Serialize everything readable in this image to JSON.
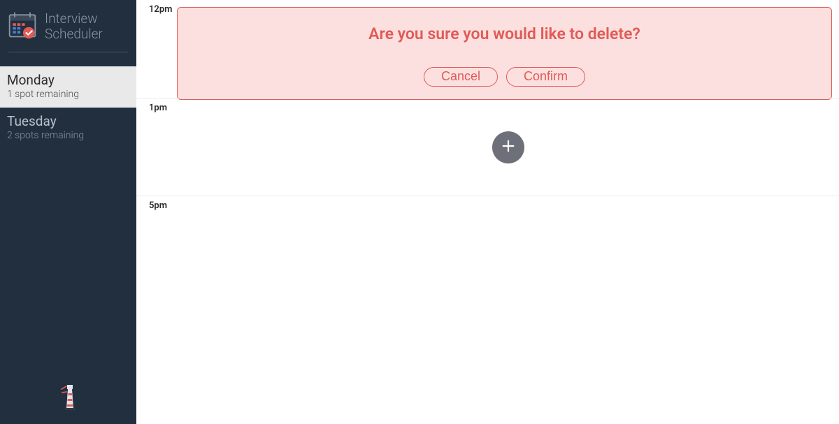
{
  "app": {
    "title_line1": "Interview",
    "title_line2": "Scheduler"
  },
  "sidebar": {
    "days": [
      {
        "name": "Monday",
        "spots": "1 spot remaining",
        "selected": true
      },
      {
        "name": "Tuesday",
        "spots": "2 spots remaining",
        "selected": false
      }
    ]
  },
  "schedule": {
    "slots": [
      {
        "time": "12pm",
        "type": "confirm"
      },
      {
        "time": "1pm",
        "type": "add"
      },
      {
        "time": "5pm",
        "type": "empty"
      }
    ]
  },
  "confirm": {
    "message": "Are you sure you would like to delete?",
    "cancel_label": "Cancel",
    "confirm_label": "Confirm"
  },
  "icons": {
    "add": "plus-icon",
    "logo": "calendar-check-icon",
    "footer": "lighthouse-icon"
  }
}
